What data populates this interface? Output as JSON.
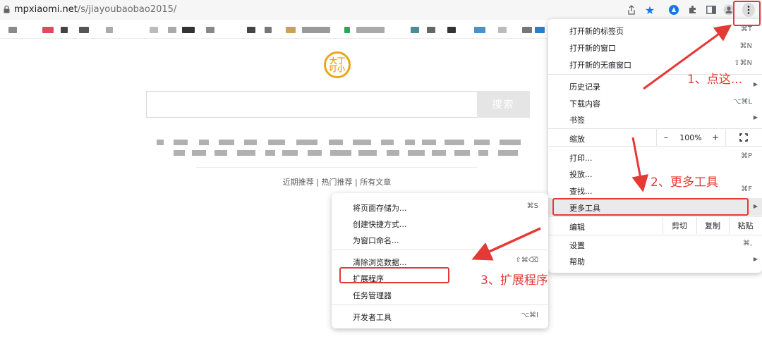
{
  "address_bar": {
    "host": "mpxiaomi.net",
    "path": "/s/jiayoubaobao2015/"
  },
  "page": {
    "logo_text": "大丁\n叮小",
    "search_button": "搜索",
    "links": "近期推荐 | 热门推荐 | 所有文章"
  },
  "chrome_menu": {
    "new_tab": "打开新的标签页",
    "new_tab_sc": "⌘T",
    "new_window": "打开新的窗口",
    "new_window_sc": "⌘N",
    "incognito": "打开新的无痕窗口",
    "incognito_sc": "⇧⌘N",
    "history": "历史记录",
    "downloads": "下载内容",
    "downloads_sc": "⌥⌘L",
    "bookmarks": "书签",
    "zoom": "缩放",
    "zoom_minus": "–",
    "zoom_value": "100%",
    "zoom_plus": "+",
    "print": "打印...",
    "print_sc": "⌘P",
    "cast": "投放...",
    "find": "查找...",
    "find_sc": "⌘F",
    "more_tools": "更多工具",
    "edit": "编辑",
    "cut": "剪切",
    "copy": "复制",
    "paste": "粘贴",
    "settings": "设置",
    "settings_sc": "⌘,",
    "help": "帮助"
  },
  "more_tools_menu": {
    "save_page": "将页面存储为...",
    "save_page_sc": "⌘S",
    "create_shortcut": "创建快捷方式...",
    "name_window": "为窗口命名...",
    "clear_data": "清除浏览数据...",
    "clear_data_sc": "⇧⌘⌫",
    "extensions": "扩展程序",
    "task_manager": "任务管理器",
    "dev_tools": "开发者工具",
    "dev_tools_sc": "⌥⌘I"
  },
  "annotations": {
    "step1": "1、点这...",
    "step2": "2、更多工具",
    "step3": "3、扩展程序"
  },
  "colors": {
    "annotation_red": "#e53935",
    "logo_orange": "#e9a61a",
    "highlight_blue": "#1a73e8"
  }
}
